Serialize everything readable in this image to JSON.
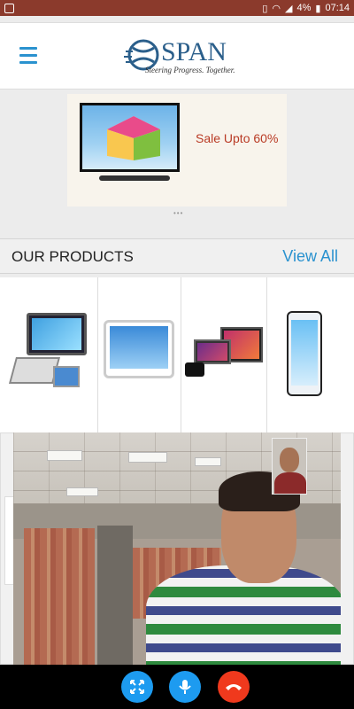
{
  "status_bar": {
    "battery": "4%",
    "time": "07:14"
  },
  "header": {
    "logo_text": "SPAN",
    "tagline": "Steering Progress. Together."
  },
  "banner": {
    "text": "Sale Upto 60%",
    "pager": "•••"
  },
  "products_section": {
    "title": "OUR PRODUCTS",
    "view_all": "View All"
  },
  "video_call": {
    "buttons": [
      "fullscreen-icon",
      "microphone-icon",
      "end-call-icon"
    ]
  },
  "colors": {
    "status_bar": "#8b3a2c",
    "accent": "#2a92cf",
    "sale_text": "#b93a24",
    "end_call": "#f0391d",
    "call_button": "#1d9bf0"
  }
}
